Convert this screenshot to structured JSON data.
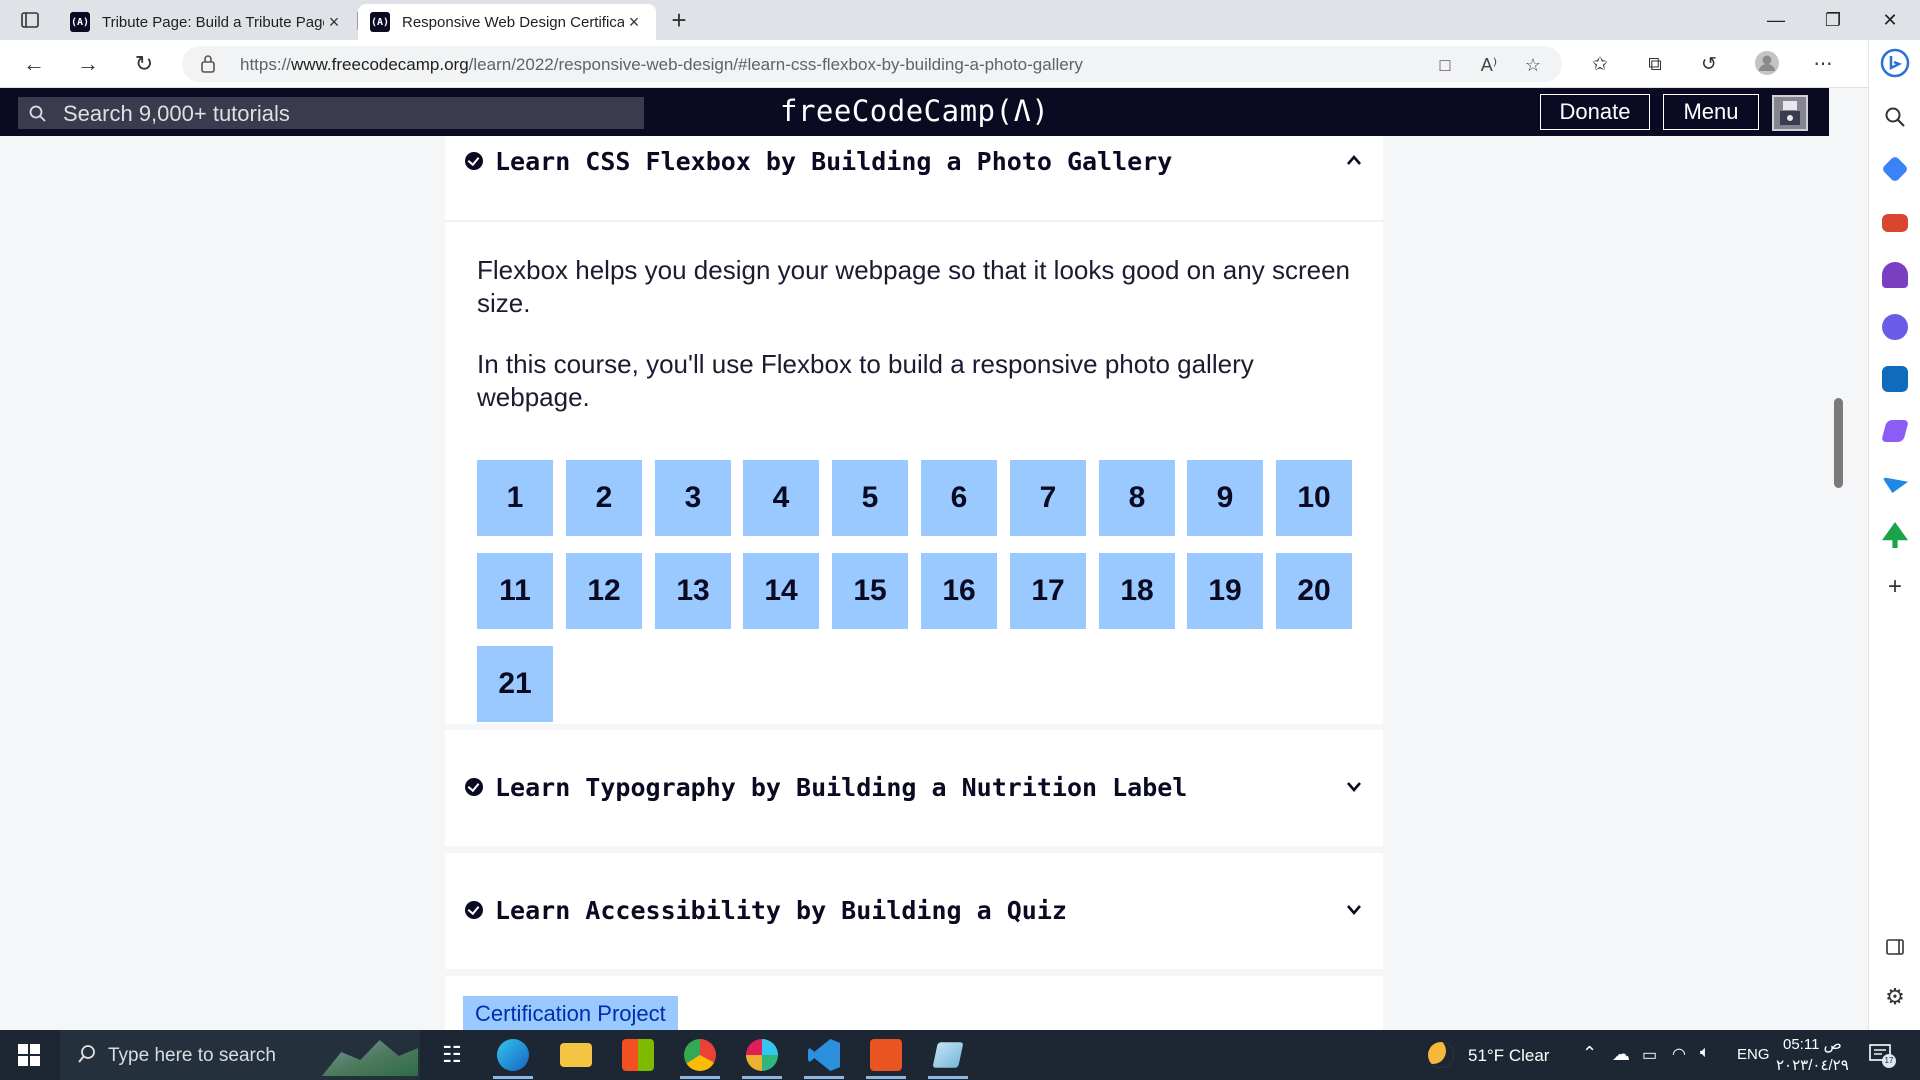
{
  "browser": {
    "tabs": [
      {
        "title": "Tribute Page: Build a Tribute Page",
        "favicon": "(A)"
      },
      {
        "title": "Responsive Web Design Certification",
        "favicon": "(A)"
      }
    ],
    "url_prefix": "https://",
    "url_domain": "www.freecodecamp.org",
    "url_path": "/learn/2022/responsive-web-design/#learn-css-flexbox-by-building-a-photo-gallery"
  },
  "fcc": {
    "search_placeholder": "Search 9,000+ tutorials",
    "logo": "freeCodeCamp(Ʌ)",
    "donate": "Donate",
    "menu": "Menu"
  },
  "blocks": [
    {
      "title": "Learn CSS Flexbox by Building a Photo Gallery",
      "expanded": true,
      "desc1": "Flexbox helps you design your webpage so that it looks good on any screen size.",
      "desc2": "In this course, you'll use Flexbox to build a responsive photo gallery webpage.",
      "steps": [
        "1",
        "2",
        "3",
        "4",
        "5",
        "6",
        "7",
        "8",
        "9",
        "10",
        "11",
        "12",
        "13",
        "14",
        "15",
        "16",
        "17",
        "18",
        "19",
        "20",
        "21"
      ]
    },
    {
      "title": "Learn Typography by Building a Nutrition Label",
      "expanded": false
    },
    {
      "title": "Learn Accessibility by Building a Quiz",
      "expanded": false
    }
  ],
  "certification_label": "Certification Project",
  "taskbar": {
    "search_placeholder": "Type here to search",
    "weather": "51°F  Clear",
    "language": "ENG",
    "time": "05:11 ص",
    "date": "٢٠٢٣/٠٤/٢٩",
    "notif_count": "17"
  },
  "colors": {
    "fcc_nav": "#0a0a23",
    "step_cell": "#99c9ff",
    "page_bg": "#f5f6f7"
  }
}
